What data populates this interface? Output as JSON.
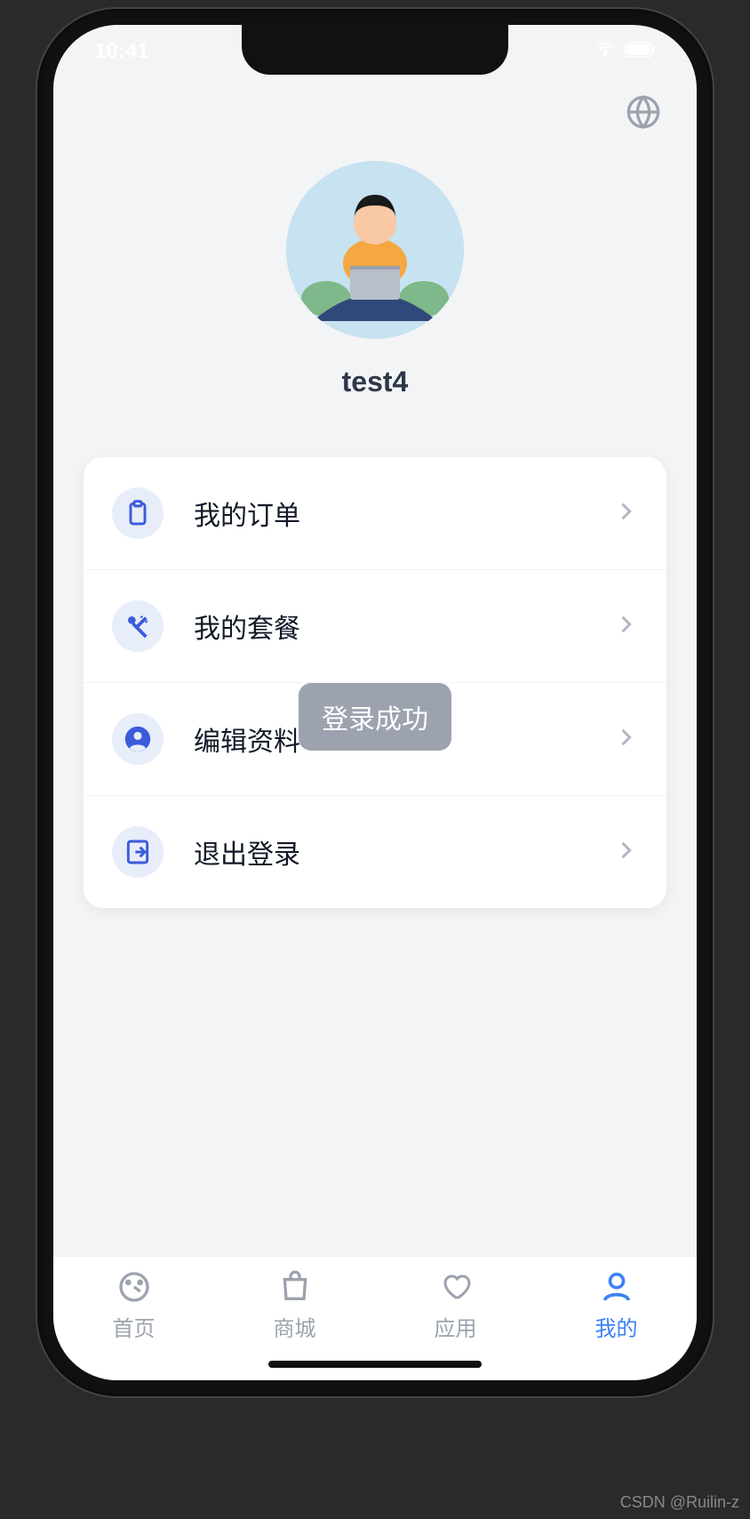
{
  "status_bar": {
    "time": "10:41"
  },
  "profile": {
    "username": "test4"
  },
  "toast": {
    "message": "登录成功"
  },
  "menu": {
    "items": [
      {
        "label": "我的订单",
        "icon": "clipboard-icon"
      },
      {
        "label": "我的套餐",
        "icon": "utensils-icon"
      },
      {
        "label": "编辑资料",
        "icon": "user-circle-icon"
      },
      {
        "label": "退出登录",
        "icon": "logout-icon"
      }
    ]
  },
  "tabbar": {
    "items": [
      {
        "label": "首页",
        "active": false
      },
      {
        "label": "商城",
        "active": false
      },
      {
        "label": "应用",
        "active": false
      },
      {
        "label": "我的",
        "active": true
      }
    ]
  },
  "watermark": "CSDN @Ruilin-z"
}
